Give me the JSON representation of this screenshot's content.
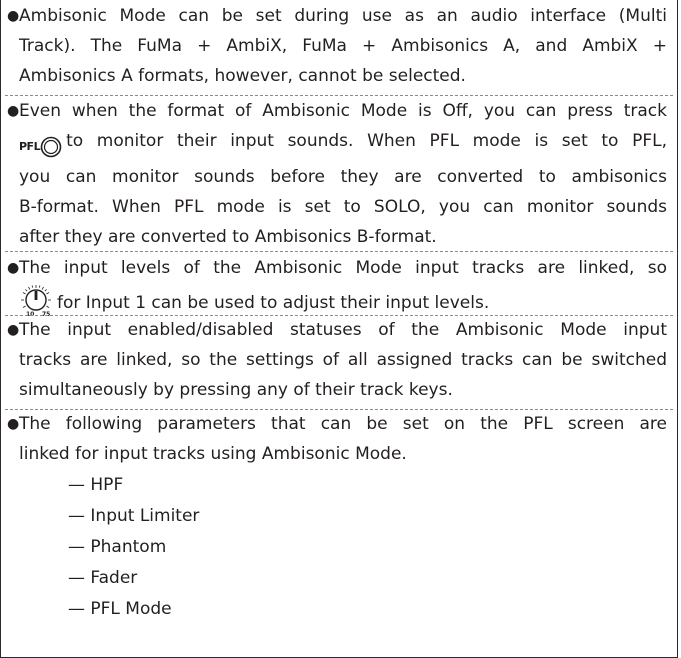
{
  "notes": [
    {
      "lines": [
        "Ambisonic Mode can be set during use as an audio interface (Multi",
        "Track). The FuMa + AmbiX, FuMa + Ambisonics A, and AmbiX +",
        "Ambisonics A formats, however, cannot be selected."
      ]
    },
    {
      "line1": "Even when the format of Ambisonic Mode is Off, you can press track",
      "key_label": "PFL",
      "line2_rest": "to monitor their input sounds. When PFL mode is set to PFL,",
      "lines_rest": [
        "you can monitor sounds before they are converted to ambisonics",
        "B-format. When PFL mode is set to SOLO, you can monitor sounds",
        "after they are converted to Ambisonics B-format."
      ]
    },
    {
      "line1": "The input levels of the Ambisonic Mode input tracks are linked, so",
      "knob_min": "10",
      "knob_max": "75",
      "line2_rest": "for Input 1 can be used to adjust their input levels."
    },
    {
      "lines": [
        "The input enabled/disabled statuses of the Ambisonic Mode input",
        "tracks are linked, so the settings of all assigned tracks can be switched",
        "simultaneously by pressing any of their track keys."
      ]
    },
    {
      "lines": [
        "The following parameters that can be set on the PFL screen are",
        "linked for input tracks using Ambisonic Mode."
      ],
      "sub_items": [
        "— HPF",
        "— Input Limiter",
        "— Phantom",
        "— Fader",
        "— PFL Mode"
      ]
    }
  ]
}
